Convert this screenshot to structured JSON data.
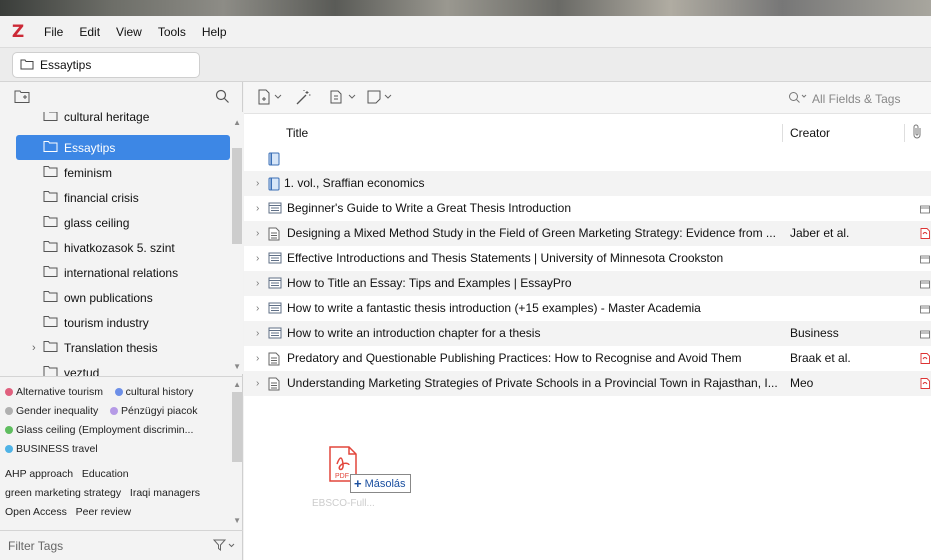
{
  "app": {
    "logo": "Z",
    "menu": [
      "File",
      "Edit",
      "View",
      "Tools",
      "Help"
    ]
  },
  "tab": {
    "label": "Essaytips"
  },
  "collections": [
    {
      "label": "cultural heritage",
      "selected": false,
      "expandable": false
    },
    {
      "label": "Essaytips",
      "selected": true,
      "expandable": false
    },
    {
      "label": "feminism",
      "selected": false,
      "expandable": false
    },
    {
      "label": "financial crisis",
      "selected": false,
      "expandable": false
    },
    {
      "label": "glass ceiling",
      "selected": false,
      "expandable": false
    },
    {
      "label": "hivatkozasok 5. szint",
      "selected": false,
      "expandable": false
    },
    {
      "label": "international relations",
      "selected": false,
      "expandable": false
    },
    {
      "label": "own publications",
      "selected": false,
      "expandable": false
    },
    {
      "label": "tourism industry",
      "selected": false,
      "expandable": false
    },
    {
      "label": "Translation thesis",
      "selected": false,
      "expandable": true
    },
    {
      "label": "veztud",
      "selected": false,
      "expandable": false
    }
  ],
  "tags": {
    "colored": [
      {
        "label": "Alternative tourism",
        "color": "#e0607e"
      },
      {
        "label": "cultural history",
        "color": "#6d8fe8"
      },
      {
        "label": "Gender inequality",
        "color": "#b0b0b0"
      },
      {
        "label": "Pénzügyi piacok",
        "color": "#b59ae6"
      },
      {
        "label": "Glass ceiling (Employment discrimin...",
        "color": "#5fbd5f"
      },
      {
        "label": "BUSINESS travel",
        "color": "#4fb3e6"
      }
    ],
    "plain": [
      "AHP approach",
      "Education",
      "green marketing strategy",
      "Iraqi managers",
      "Open Access",
      "Peer review"
    ],
    "filter_placeholder": "Filter Tags"
  },
  "search": {
    "placeholder": "All Fields & Tags"
  },
  "columns": {
    "title": "Title",
    "creator": "Creator"
  },
  "items": [
    {
      "title": "",
      "creator": "",
      "type": "book",
      "attachment": "",
      "expandable": false
    },
    {
      "title": "1. vol., Sraffian economics",
      "creator": "",
      "type": "book",
      "attachment": "",
      "expandable": true
    },
    {
      "title": "Beginner's Guide to Write a Great Thesis Introduction",
      "creator": "",
      "type": "webpage",
      "attachment": "snapshot",
      "expandable": true
    },
    {
      "title": "Designing a Mixed Method Study in the Field of Green Marketing Strategy: Evidence from ...",
      "creator": "Jaber et al.",
      "type": "article",
      "attachment": "pdf",
      "expandable": true
    },
    {
      "title": "Effective Introductions and Thesis Statements | University of Minnesota Crookston",
      "creator": "",
      "type": "webpage",
      "attachment": "snapshot",
      "expandable": true
    },
    {
      "title": "How to Title an Essay: Tips and Examples | EssayPro",
      "creator": "",
      "type": "webpage",
      "attachment": "snapshot",
      "expandable": true
    },
    {
      "title": "How to write a fantastic thesis introduction (+15 examples) - Master Academia",
      "creator": "",
      "type": "webpage",
      "attachment": "snapshot",
      "expandable": true
    },
    {
      "title": "How to write an introduction chapter for a thesis",
      "creator": "Business",
      "type": "webpage",
      "attachment": "snapshot",
      "expandable": true
    },
    {
      "title": "Predatory and Questionable Publishing Practices: How to Recognise and Avoid Them",
      "creator": "Braak et al.",
      "type": "article",
      "attachment": "pdf",
      "expandable": true
    },
    {
      "title": "Understanding Marketing Strategies of Private Schools in a Provincial Town in Rajasthan, I...",
      "creator": "Meo",
      "type": "article",
      "attachment": "pdf",
      "expandable": true
    }
  ],
  "drag": {
    "file_label": "EBSCO-Full...",
    "pdf_badge": "PDF",
    "copy_label": "Másolás",
    "plus": "+"
  }
}
